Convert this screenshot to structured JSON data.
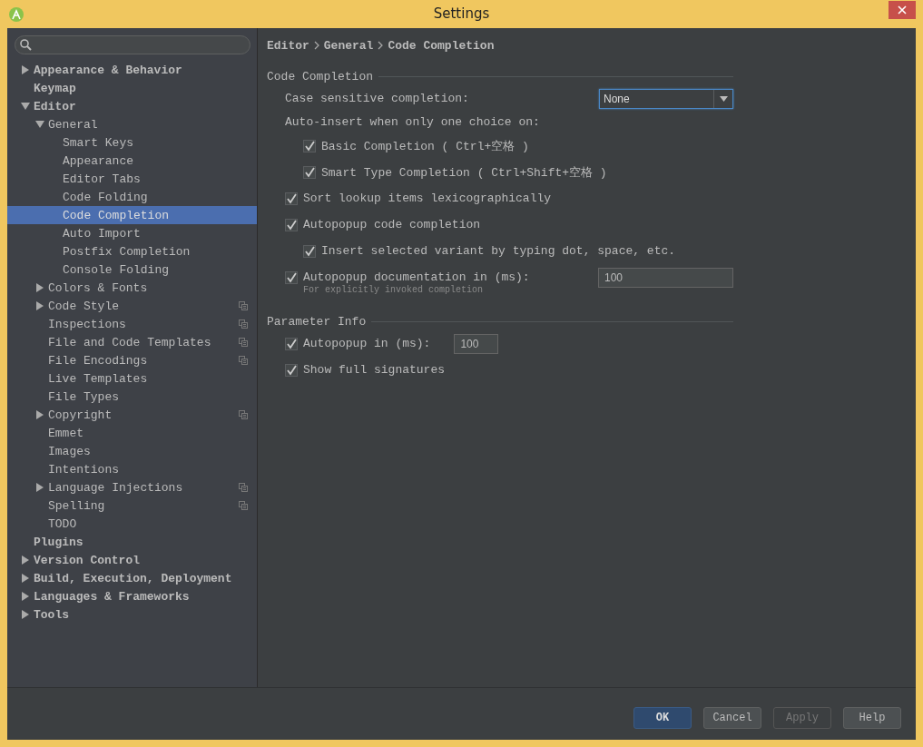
{
  "window": {
    "title": "Settings"
  },
  "sidebar": {
    "items": [
      {
        "label": "Appearance & Behavior",
        "expanded": false,
        "selected": false
      },
      {
        "label": "Keymap",
        "selected": false
      },
      {
        "label": "Editor",
        "expanded": true,
        "selected": false,
        "children": [
          {
            "label": "General",
            "expanded": true,
            "selected": false,
            "children": [
              {
                "label": "Smart Keys",
                "selected": false
              },
              {
                "label": "Appearance",
                "selected": false
              },
              {
                "label": "Editor Tabs",
                "selected": false
              },
              {
                "label": "Code Folding",
                "selected": false
              },
              {
                "label": "Code Completion",
                "selected": true
              },
              {
                "label": "Auto Import",
                "selected": false
              },
              {
                "label": "Postfix Completion",
                "selected": false
              },
              {
                "label": "Console Folding",
                "selected": false
              }
            ]
          },
          {
            "label": "Colors & Fonts",
            "expanded": false,
            "selected": false
          },
          {
            "label": "Code Style",
            "expanded": false,
            "selected": false,
            "project_level": true
          },
          {
            "label": "Inspections",
            "selected": false,
            "project_level": true
          },
          {
            "label": "File and Code Templates",
            "selected": false,
            "project_level": true
          },
          {
            "label": "File Encodings",
            "selected": false,
            "project_level": true
          },
          {
            "label": "Live Templates",
            "selected": false
          },
          {
            "label": "File Types",
            "selected": false
          },
          {
            "label": "Copyright",
            "expanded": false,
            "selected": false,
            "project_level": true
          },
          {
            "label": "Emmet",
            "selected": false
          },
          {
            "label": "Images",
            "selected": false
          },
          {
            "label": "Intentions",
            "selected": false
          },
          {
            "label": "Language Injections",
            "expanded": false,
            "selected": false,
            "project_level": true
          },
          {
            "label": "Spelling",
            "selected": false,
            "project_level": true
          },
          {
            "label": "TODO",
            "selected": false
          }
        ]
      },
      {
        "label": "Plugins",
        "selected": false
      },
      {
        "label": "Version Control",
        "expanded": false,
        "selected": false
      },
      {
        "label": "Build, Execution, Deployment",
        "expanded": false,
        "selected": false
      },
      {
        "label": "Languages & Frameworks",
        "expanded": false,
        "selected": false
      },
      {
        "label": "Tools",
        "expanded": false,
        "selected": false
      }
    ]
  },
  "breadcrumb": [
    "Editor",
    "General",
    "Code Completion"
  ],
  "sections": [
    {
      "title": "Code Completion",
      "rows": [
        {
          "kind": "dropdown",
          "label": "Case sensitive completion:",
          "value": "None"
        },
        {
          "kind": "label",
          "label": "Auto-insert when only one choice on:",
          "children": [
            {
              "kind": "checkbox",
              "label": "Basic Completion ( Ctrl+空格 )",
              "checked": true
            },
            {
              "kind": "checkbox",
              "label": "Smart Type Completion ( Ctrl+Shift+空格 )",
              "checked": true
            }
          ]
        },
        {
          "kind": "checkbox",
          "label": "Sort lookup items lexicographically",
          "checked": true
        },
        {
          "kind": "checkbox",
          "label": "Autopopup code completion",
          "checked": true,
          "children": [
            {
              "kind": "checkbox",
              "label": "Insert selected variant by typing dot, space, etc.",
              "checked": true
            }
          ]
        },
        {
          "kind": "checkbox",
          "label": "Autopopup documentation in (ms):",
          "checked": true,
          "value": "100",
          "hint": "For explicitly invoked completion"
        }
      ]
    },
    {
      "title": "Parameter Info",
      "rows": [
        {
          "kind": "checkbox",
          "label": "Autopopup in (ms):",
          "checked": true,
          "value": "100"
        },
        {
          "kind": "checkbox",
          "label": "Show full signatures",
          "checked": true
        }
      ]
    }
  ],
  "buttons": [
    {
      "label": "OK",
      "default": true,
      "disabled": false
    },
    {
      "label": "Cancel",
      "default": false,
      "disabled": false
    },
    {
      "label": "Apply",
      "default": false,
      "disabled": true
    },
    {
      "label": "Help",
      "default": false,
      "disabled": false
    }
  ]
}
